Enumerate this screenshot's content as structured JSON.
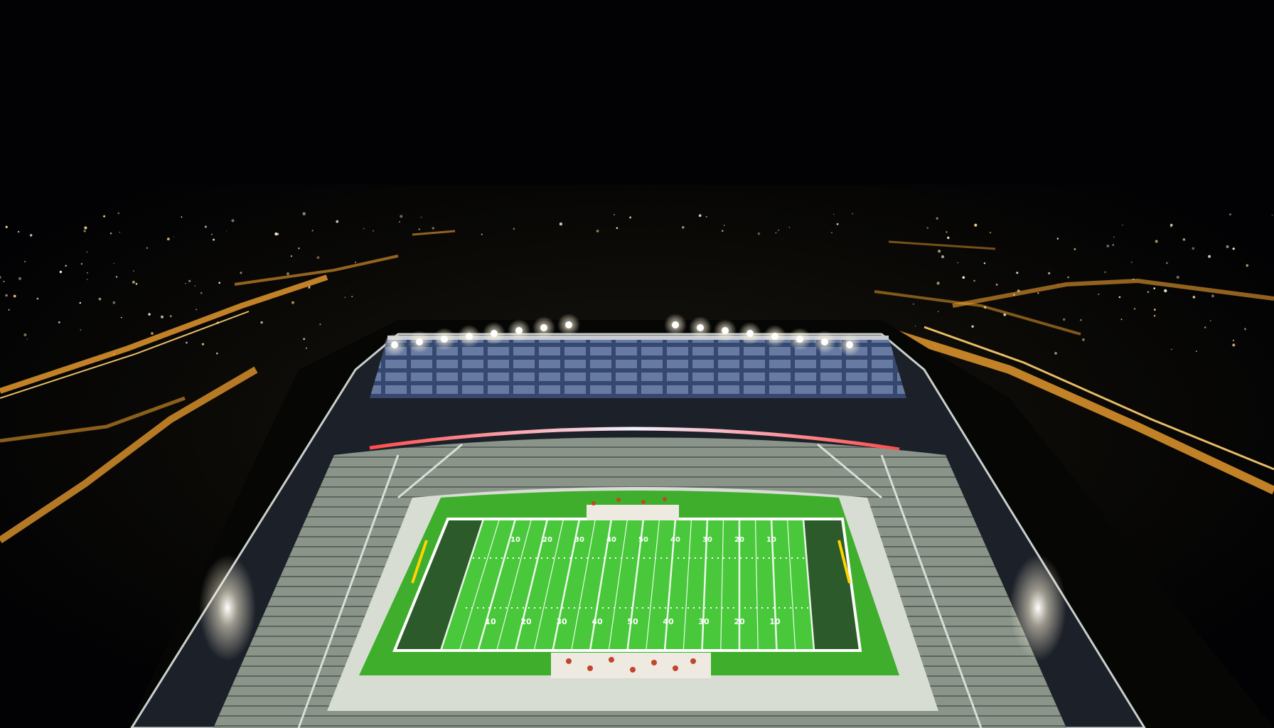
{
  "scene": {
    "colors": {
      "sky": "#020204",
      "ground": "#0b0a06",
      "road_glow": "#f0a030",
      "city_lights": "#fff2c8",
      "turf": "#3fae2c",
      "turf_dark": "#2d5a2a",
      "seats": "#8a9488",
      "upper_deck_seats": "#3a4c78",
      "concourse": "#d8ddd4",
      "floodlight": "#ffffff",
      "ribbon_red": "#ff4a4a",
      "ribbon_white": "#f4f0ff"
    }
  },
  "field": {
    "yard_numbers_top": [
      "10",
      "20",
      "30",
      "40",
      "50",
      "40",
      "30",
      "20",
      "10"
    ],
    "yard_numbers_bottom": [
      "10",
      "20",
      "30",
      "40",
      "50",
      "40",
      "30",
      "20",
      "10"
    ]
  }
}
